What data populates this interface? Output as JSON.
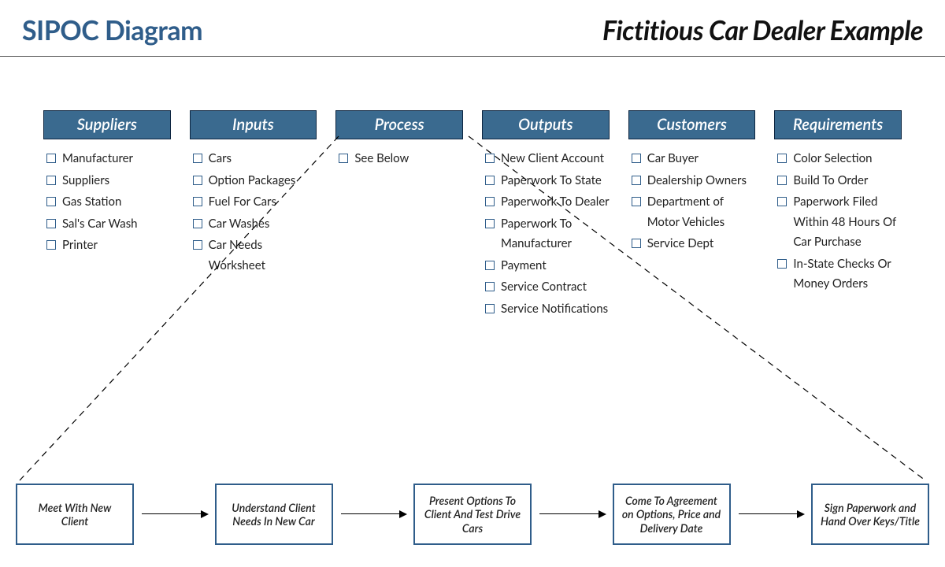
{
  "header": {
    "title_left": "SIPOC Diagram",
    "title_right": "Fictitious Car Dealer Example"
  },
  "columns": [
    {
      "heading": "Suppliers",
      "items": [
        "Manufacturer",
        "Suppliers",
        "Gas Station",
        "Sal's Car Wash",
        "Printer"
      ]
    },
    {
      "heading": "Inputs",
      "items": [
        "Cars",
        "Option Packages",
        "Fuel For Cars",
        "Car Washes",
        "Car Needs Worksheet"
      ]
    },
    {
      "heading": "Process",
      "items": [
        "See Below"
      ]
    },
    {
      "heading": "Outputs",
      "items": [
        "New Client Account",
        "Paperwork To State",
        "Paperwork To Dealer",
        "Paperwork To Manufacturer",
        "Payment",
        "Service Contract",
        "Service Notifications"
      ]
    },
    {
      "heading": "Customers",
      "items": [
        "Car Buyer",
        "Dealership Owners",
        "Department of Motor Vehicles",
        "Service Dept"
      ]
    },
    {
      "heading": "Requirements",
      "items": [
        "Color Selection",
        "Build To Order",
        "Paperwork Filed Within 48 Hours Of Car Purchase",
        "In-State Checks Or Money Orders"
      ]
    }
  ],
  "process_steps": [
    "Meet With New Client",
    "Understand Client Needs In New Car",
    "Present Options To Client And Test Drive Cars",
    "Come To Agreement on Options, Price and Delivery Date",
    "Sign Paperwork and Hand Over Keys/Title"
  ]
}
